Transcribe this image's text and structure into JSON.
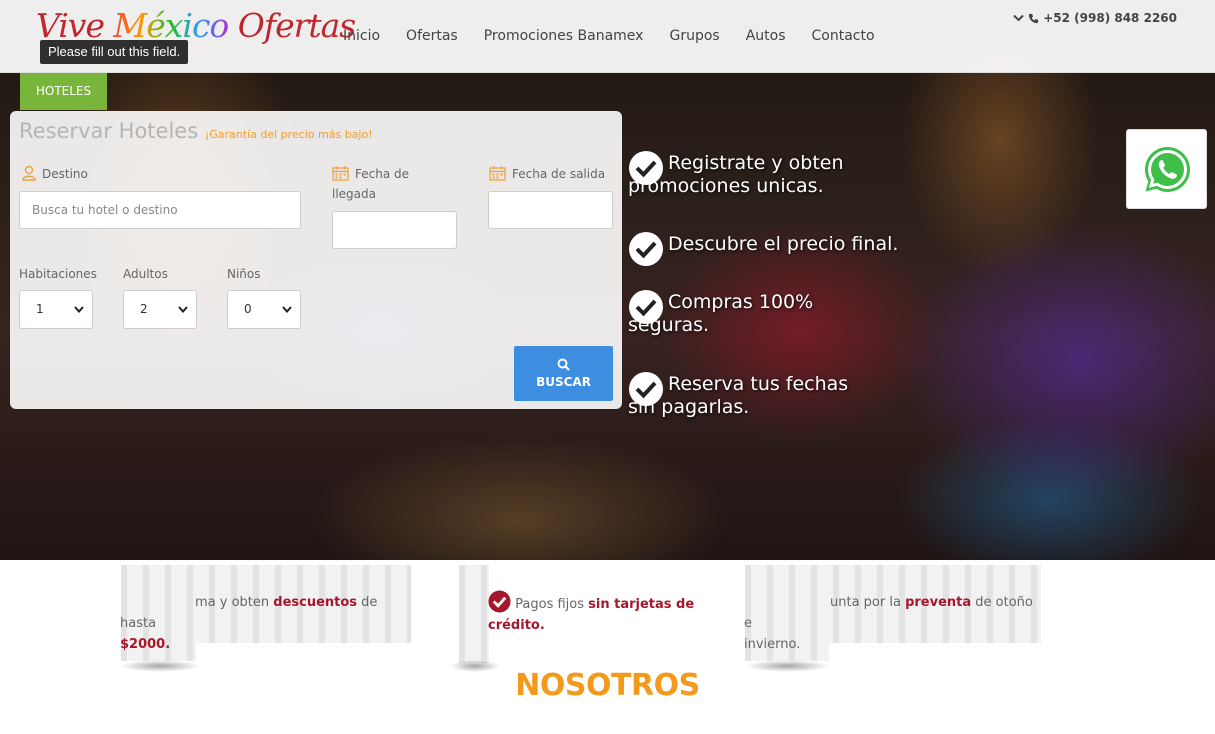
{
  "header": {
    "logo": {
      "part1": "Vive ",
      "part2": "México",
      "part3": " Ofertas"
    },
    "tooltip": "Please fill out this field.",
    "nav": [
      "Inicio",
      "Ofertas",
      "Promociones Banamex",
      "Grupos",
      "Autos",
      "Contacto"
    ],
    "phone": "+52 (998) 848 2260"
  },
  "tabs": {
    "hoteles": "HOTELES"
  },
  "search": {
    "title": "Reservar Hoteles",
    "tagline": "¡Garantía del precio más bajo!",
    "destino_label": "Destino",
    "destino_placeholder": "Busca tu hotel o destino",
    "llegada_label": "Fecha de llegada",
    "salida_label": "Fecha de salida",
    "habitaciones_label": "Habitaciones",
    "habitaciones_value": "1",
    "adultos_label": "Adultos",
    "adultos_value": "2",
    "ninos_label": "Niños",
    "ninos_value": "0",
    "buscar_label": "BUSCAR"
  },
  "features": [
    "Registrate y obten promociones unicas.",
    "Descubre el precio final.",
    "Compras 100% seguras.",
    "Reserva tus fechas sin pagarlas."
  ],
  "promos": {
    "p1_a": "ma y obten ",
    "p1_b": "descuentos",
    "p1_c": " de hasta",
    "p1_d": "$2000.",
    "p2_a": "Pagos fijos ",
    "p2_b": "sin tarjetas de crédito.",
    "p3_a": "unta por la ",
    "p3_b": "preventa",
    "p3_c": " de otoño e",
    "p3_d": "invierno."
  },
  "section_title": "NOSOTROS",
  "colors": {
    "accent_green": "#7ab53b",
    "button_blue": "#3d8de0",
    "heading_orange": "#f39a1d",
    "promo_red": "#a5172a"
  }
}
